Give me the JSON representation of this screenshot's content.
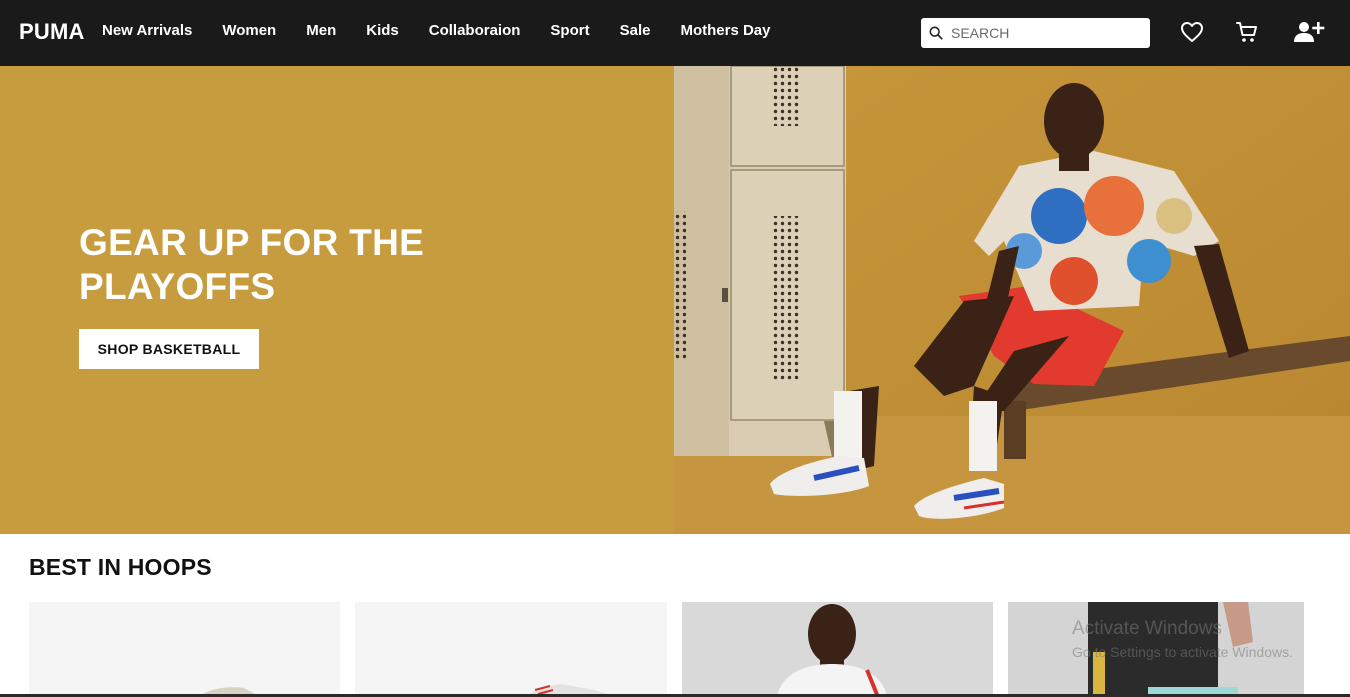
{
  "header": {
    "logo": "PUMA",
    "nav": [
      "New Arrivals",
      "Women",
      "Men",
      "Kids",
      "Collaboraion",
      "Sport",
      "Sale",
      "Mothers Day"
    ],
    "search_placeholder": "SEARCH",
    "icons": [
      "search-icon",
      "heart-icon",
      "cart-icon",
      "user-add-icon"
    ]
  },
  "hero": {
    "title": "GEAR UP FOR THE PLAYOFFS",
    "button": "SHOP BASKETBALL",
    "bg_color": "#c79c3e"
  },
  "section": {
    "title": "BEST IN HOOPS"
  },
  "watermark": {
    "line1": "Activate Windows",
    "line2": "Go to Settings to activate Windows."
  }
}
